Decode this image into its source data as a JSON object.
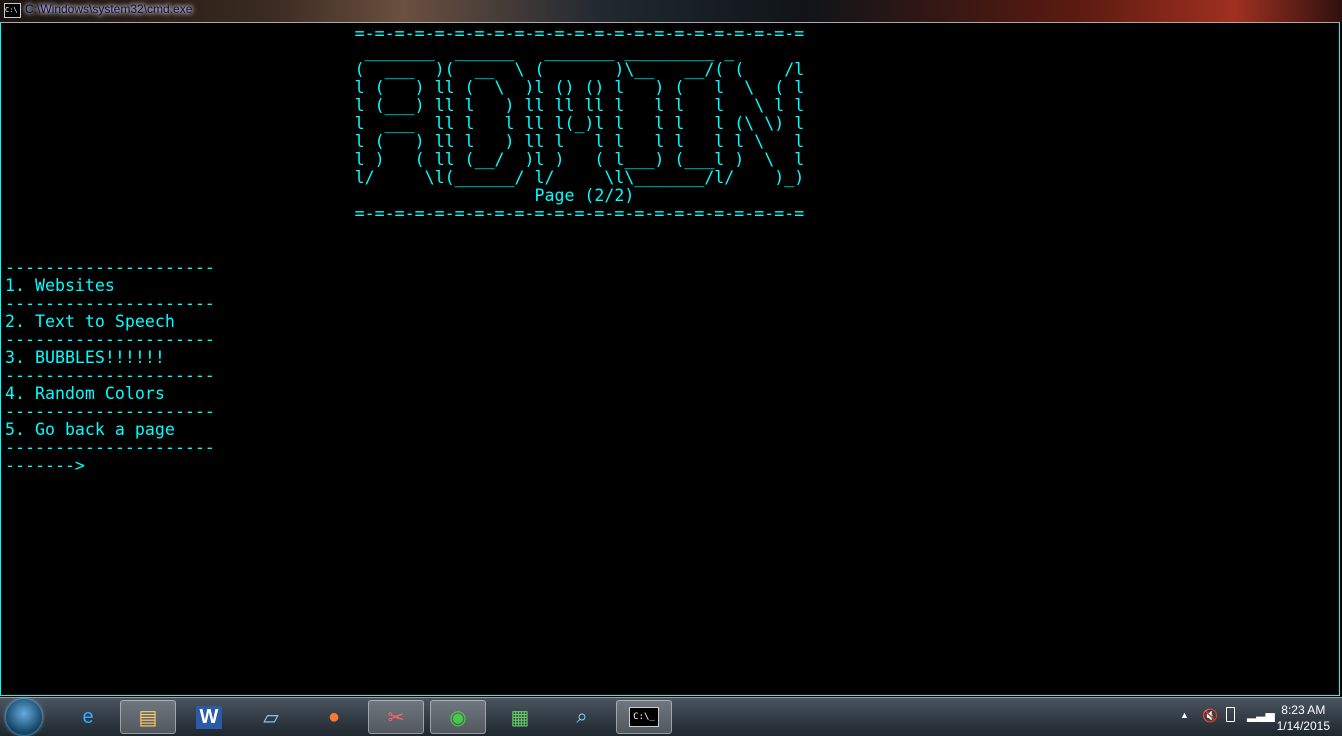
{
  "window": {
    "title": "C:\\Windows\\system32\\cmd.exe"
  },
  "console": {
    "lines": [
      "                                   =-=-=-=-=-=-=-=-=-=-=-=-=-=-=-=-=-=-=-=-=-=-=",
      "                                    _______  ______   _______ _________ _",
      "                                   (  ___  )(  __  \\ (       )\\__   __/( (    /l",
      "                                   l (   ) ll (  \\  )l () () l   ) (   l  \\  ( l",
      "                                   l (___) ll l   ) ll ll ll l   l l   l   \\ l l",
      "                                   l  ___  ll l   l ll l(_)l l   l l   l (\\ \\) l",
      "                                   l (   ) ll l   ) ll l   l l   l l   l l \\   l",
      "                                   l )   ( ll (__/  )l )   ( l___) (___l )  \\  l",
      "                                   l/     \\l(______/ l/     \\l\\_______/l/    )_)",
      "                                                     Page (2/2)",
      "                                   =-=-=-=-=-=-=-=-=-=-=-=-=-=-=-=-=-=-=-=-=-=-=",
      "",
      "",
      "---------------------",
      "1. Websites",
      "---------------------",
      "2. Text to Speech",
      "---------------------",
      "3. BUBBLES!!!!!!",
      "---------------------",
      "4. Random Colors",
      "---------------------",
      "5. Go back a page",
      "---------------------",
      "------->"
    ]
  },
  "taskbar": {
    "items": [
      {
        "name": "internet-explorer",
        "glyph": "e",
        "color": "#3af"
      },
      {
        "name": "file-explorer",
        "glyph": "▤",
        "color": "#fc6"
      },
      {
        "name": "word",
        "glyph": "W",
        "color": "#fff"
      },
      {
        "name": "notepad",
        "glyph": "▱",
        "color": "#9cf"
      },
      {
        "name": "firefox",
        "glyph": "●",
        "color": "#f73"
      },
      {
        "name": "snipping-tool",
        "glyph": "✂",
        "color": "#f66"
      },
      {
        "name": "chrome",
        "glyph": "◉",
        "color": "#4c4"
      },
      {
        "name": "task-manager",
        "glyph": "▦",
        "color": "#6c6"
      },
      {
        "name": "remote-desktop",
        "glyph": "⌕",
        "color": "#8cf"
      },
      {
        "name": "command-prompt",
        "glyph": "C:\\_",
        "color": "#fff"
      }
    ],
    "clock_time": "8:23 AM",
    "clock_date": "1/14/2015"
  },
  "colors": {
    "console_text": "#00ffff",
    "console_bg": "#000000"
  }
}
